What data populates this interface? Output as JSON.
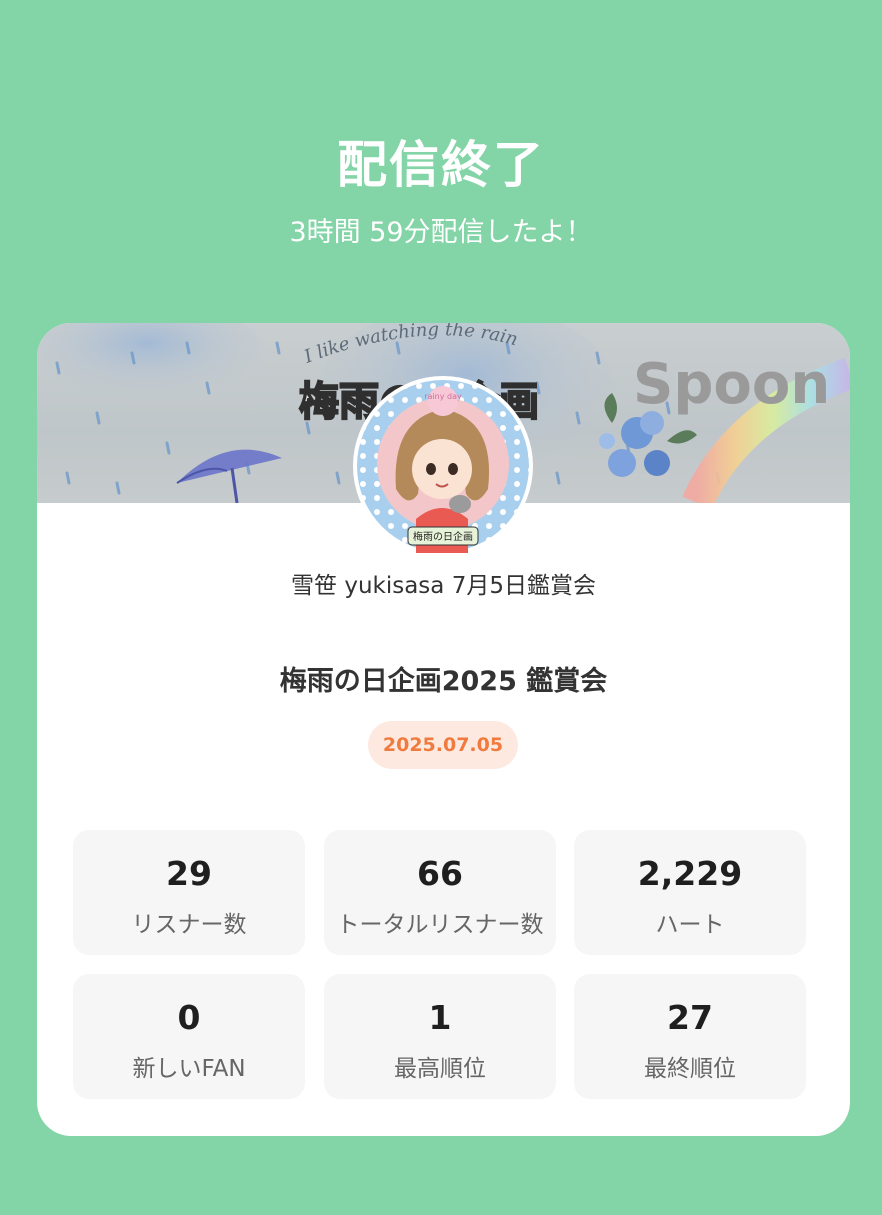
{
  "header": {
    "title": "配信終了",
    "subtitle": "3時間 59分配信したよ！"
  },
  "banner": {
    "title_text": "梅雨の日企画",
    "curved_text": "I like watching the rain",
    "brand_text": "Spoon",
    "avatar_badge_text": "rainy day",
    "avatar_label_text": "梅雨の日企画"
  },
  "channel": {
    "name": "雪笹 yukisasa 7月5日鑑賞会"
  },
  "live": {
    "title": "梅雨の日企画2025 鑑賞会",
    "date": "2025.07.05"
  },
  "stats": [
    {
      "value": "29",
      "label": "リスナー数"
    },
    {
      "value": "66",
      "label": "トータルリスナー数"
    },
    {
      "value": "2,229",
      "label": "ハート"
    },
    {
      "value": "0",
      "label": "新しいFAN"
    },
    {
      "value": "1",
      "label": "最高順位"
    },
    {
      "value": "27",
      "label": "最終順位"
    }
  ],
  "colors": {
    "background": "#83d4a6",
    "date_badge_bg": "#fde9e0",
    "date_badge_text": "#f07b3f"
  }
}
